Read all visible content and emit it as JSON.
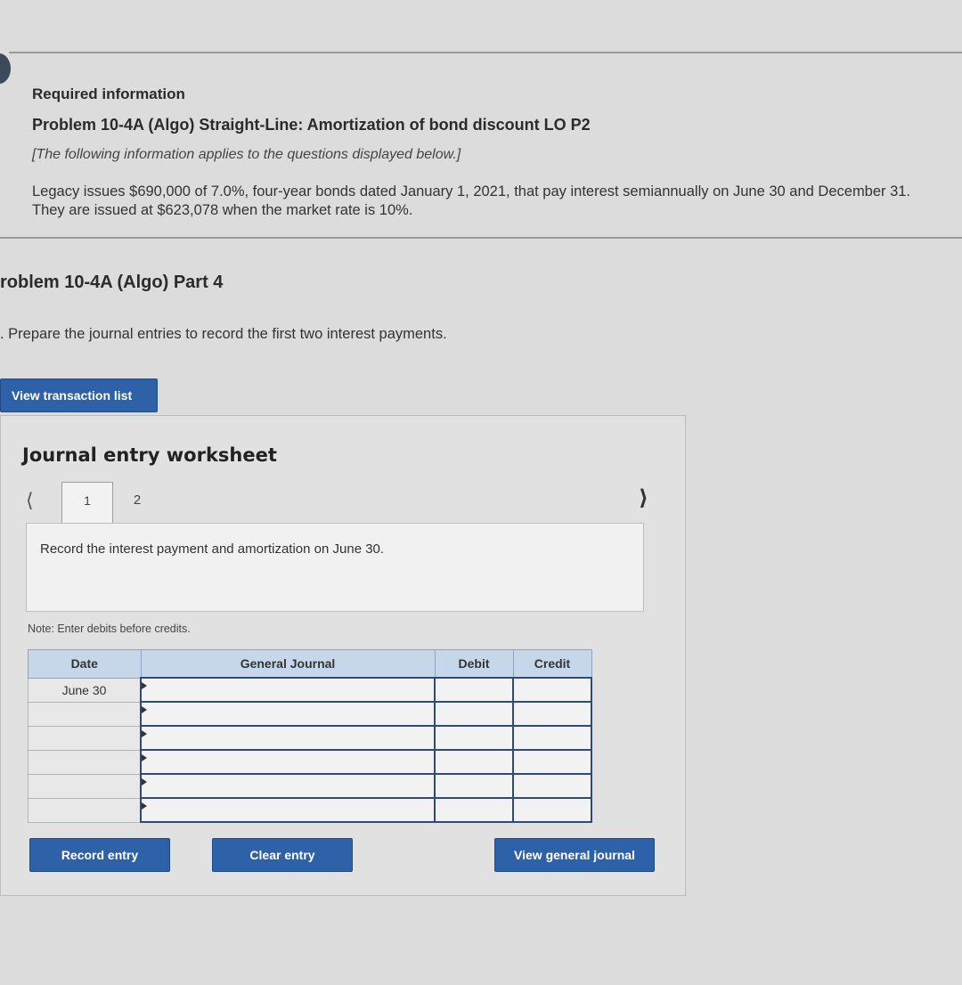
{
  "intro": {
    "required": "Required information",
    "problem_title": "Problem 10-4A (Algo) Straight-Line: Amortization of bond discount LO P2",
    "applies_note": "[The following information applies to the questions displayed below.]",
    "description": "Legacy issues $690,000 of 7.0%, four-year bonds dated January 1, 2021, that pay interest semiannually on June 30 and December 31. They are issued at $623,078 when the market rate is 10%."
  },
  "part": {
    "title": "roblem 10-4A (Algo) Part 4",
    "instruction": ". Prepare the journal entries to record the first two interest payments."
  },
  "buttons": {
    "view_transactions": "View transaction list",
    "record_entry": "Record entry",
    "clear_entry": "Clear entry",
    "view_general_journal": "View general journal"
  },
  "worksheet": {
    "title": "Journal entry worksheet",
    "prev_icon": "chevron-left",
    "next_icon": "chevron-right",
    "tabs": [
      "1",
      "2"
    ],
    "record_text": "Record the interest payment and amortization on June 30.",
    "note": "Note: Enter debits before credits."
  },
  "table": {
    "headers": {
      "date": "Date",
      "journal": "General Journal",
      "debit": "Debit",
      "credit": "Credit"
    },
    "rows": [
      {
        "date": "June 30"
      },
      {
        "date": ""
      },
      {
        "date": ""
      },
      {
        "date": ""
      },
      {
        "date": ""
      },
      {
        "date": ""
      }
    ]
  }
}
